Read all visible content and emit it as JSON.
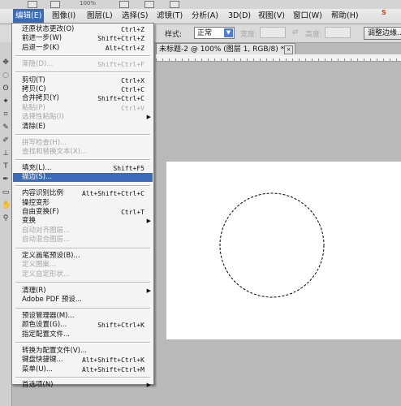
{
  "topbar": {
    "zoom": "100%"
  },
  "menubar": {
    "items": [
      {
        "label": "编辑(E)"
      },
      {
        "label": "图像(I)"
      },
      {
        "label": "图层(L)"
      },
      {
        "label": "选择(S)"
      },
      {
        "label": "滤镜(T)"
      },
      {
        "label": "分析(A)"
      },
      {
        "label": "3D(D)"
      },
      {
        "label": "视图(V)"
      },
      {
        "label": "窗口(W)"
      },
      {
        "label": "帮助(H)"
      }
    ],
    "logo": "S"
  },
  "options": {
    "style_label": "样式:",
    "style_value": "正常",
    "width_label": "宽度:",
    "height_label": "高度:",
    "refine_button": "调整边缘..."
  },
  "document": {
    "tab_title": "未标题-2 @ 100% (图层 1, RGB/8) *",
    "close": "×"
  },
  "edit_menu": {
    "items": [
      {
        "label": "还原状态更改(O)",
        "shortcut": "Ctrl+Z",
        "disabled": false
      },
      {
        "label": "前进一步(W)",
        "shortcut": "Shift+Ctrl+Z",
        "disabled": false
      },
      {
        "label": "后退一步(K)",
        "shortcut": "Alt+Ctrl+Z",
        "disabled": false
      },
      {
        "label": "渐隐(D)...",
        "shortcut": "Shift+Ctrl+F",
        "disabled": true
      },
      {
        "label": "剪切(T)",
        "shortcut": "Ctrl+X",
        "disabled": false
      },
      {
        "label": "拷贝(C)",
        "shortcut": "Ctrl+C",
        "disabled": false
      },
      {
        "label": "合并拷贝(Y)",
        "shortcut": "Shift+Ctrl+C",
        "disabled": false
      },
      {
        "label": "粘贴(P)",
        "shortcut": "Ctrl+V",
        "disabled": true
      },
      {
        "label": "选择性粘贴(I)",
        "shortcut": "",
        "disabled": true,
        "submenu": true
      },
      {
        "label": "清除(E)",
        "shortcut": "",
        "disabled": false
      },
      {
        "label": "拼写检查(H)...",
        "shortcut": "",
        "disabled": true
      },
      {
        "label": "查找和替换文本(X)...",
        "shortcut": "",
        "disabled": true
      },
      {
        "label": "填充(L)...",
        "shortcut": "Shift+F5",
        "disabled": false
      },
      {
        "label": "描边(S)...",
        "shortcut": "",
        "disabled": false,
        "highlighted": true
      },
      {
        "label": "内容识别比例",
        "shortcut": "Alt+Shift+Ctrl+C",
        "disabled": false
      },
      {
        "label": "操控变形",
        "shortcut": "",
        "disabled": false
      },
      {
        "label": "自由变换(F)",
        "shortcut": "Ctrl+T",
        "disabled": false
      },
      {
        "label": "变换",
        "shortcut": "",
        "disabled": false,
        "submenu": true
      },
      {
        "label": "自动对齐图层...",
        "shortcut": "",
        "disabled": true
      },
      {
        "label": "自动混合图层...",
        "shortcut": "",
        "disabled": true
      },
      {
        "label": "定义画笔预设(B)...",
        "shortcut": "",
        "disabled": false
      },
      {
        "label": "定义图案...",
        "shortcut": "",
        "disabled": true
      },
      {
        "label": "定义自定形状...",
        "shortcut": "",
        "disabled": true
      },
      {
        "label": "清理(R)",
        "shortcut": "",
        "disabled": false,
        "submenu": true
      },
      {
        "label": "Adobe PDF 预设...",
        "shortcut": "",
        "disabled": false
      },
      {
        "label": "预设管理器(M)...",
        "shortcut": "",
        "disabled": false
      },
      {
        "label": "颜色设置(G)...",
        "shortcut": "Shift+Ctrl+K",
        "disabled": false
      },
      {
        "label": "指定配置文件...",
        "shortcut": "",
        "disabled": false
      },
      {
        "label": "转换为配置文件(V)...",
        "shortcut": "",
        "disabled": false
      },
      {
        "label": "键盘快捷键...",
        "shortcut": "Alt+Shift+Ctrl+K",
        "disabled": false
      },
      {
        "label": "菜单(U)...",
        "shortcut": "Alt+Shift+Ctrl+M",
        "disabled": false
      },
      {
        "label": "首选项(N)",
        "shortcut": "",
        "disabled": false,
        "submenu": true
      }
    ]
  },
  "colors": {
    "highlight": "#3a6ab8",
    "canvas": "#ffffff",
    "workspace": "#b9b9b9"
  }
}
